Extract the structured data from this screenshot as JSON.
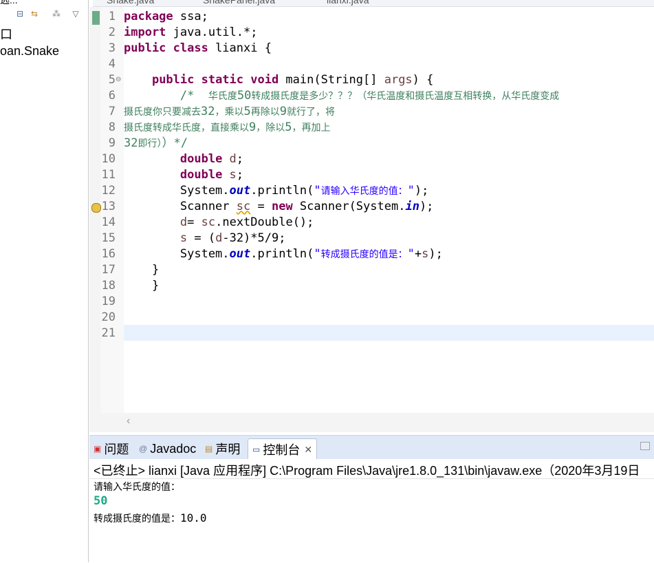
{
  "left": {
    "clipped_top": "逃...",
    "items": [
      "口",
      "oan.Snake"
    ]
  },
  "tabs": [
    "Snake.java",
    "SnakePanel.java",
    "lianxi.java"
  ],
  "editor": {
    "lines": [
      {
        "n": "1"
      },
      {
        "n": "2"
      },
      {
        "n": "3"
      },
      {
        "n": "4"
      },
      {
        "n": "5"
      },
      {
        "n": "6"
      },
      {
        "n": "7"
      },
      {
        "n": "8"
      },
      {
        "n": "9"
      },
      {
        "n": "10"
      },
      {
        "n": "11"
      },
      {
        "n": "12"
      },
      {
        "n": "13"
      },
      {
        "n": "14"
      },
      {
        "n": "15"
      },
      {
        "n": "16"
      },
      {
        "n": "17"
      },
      {
        "n": "18"
      },
      {
        "n": "19"
      },
      {
        "n": "20"
      },
      {
        "n": "21"
      }
    ],
    "code": {
      "l1_kw": "package",
      "l1_rest": " ssa;",
      "l2_kw": "import",
      "l2_rest": " java.util.*;",
      "l3_kw": "public class",
      "l3_rest": " lianxi {",
      "l5_indent": "    ",
      "l5_kw": "public static void",
      "l5_a": " main(String[] ",
      "l5_var": "args",
      "l5_b": ") {",
      "l6_a": "        /*  ",
      "l6_cn1": "华氏度",
      "l6_num": "50",
      "l6_cn2": "转成摄氏度是多少？？？（华氏温度和摄氏温度互相转换，从华氏度变成",
      "l7_cn1": "摄氏度你只要减去",
      "l7_n1": "32",
      "l7_cn2": "，乘以",
      "l7_n2": "5",
      "l7_cn3": "再除以",
      "l7_n3": "9",
      "l7_cn4": "就行了，将",
      "l8_cn1": "摄氏度转成华氏度，直接乘以",
      "l8_n1": "9",
      "l8_cn2": "，除以",
      "l8_n2": "5",
      "l8_cn3": "，再加上",
      "l9_n": "32",
      "l9_cn": "即行）",
      "l9_end": "）*/",
      "l10_i": "        ",
      "l10_kw": "double",
      "l10_var": " d",
      "l10_end": ";",
      "l11_i": "        ",
      "l11_kw": "double",
      "l11_var": " s",
      "l11_end": ";",
      "l12_a": "        System.",
      "l12_fld": "out",
      "l12_b": ".println(",
      "l12_q1": "\"",
      "l12_str": "请输入华氏度的值：",
      "l12_q2": "\"",
      "l12_c": ");",
      "l13_a": "        Scanner ",
      "l13_var": "sc",
      "l13_b": " = ",
      "l13_kw": "new",
      "l13_c": " Scanner(System.",
      "l13_fld": "in",
      "l13_d": ");",
      "l14_a": "        ",
      "l14_var": "d",
      "l14_b": "= ",
      "l14_var2": "sc",
      "l14_c": ".nextDouble();",
      "l15_a": "        ",
      "l15_var": "s",
      "l15_b": " = (",
      "l15_var2": "d",
      "l15_c": "-32)*5/9;",
      "l16_a": "        System.",
      "l16_fld": "out",
      "l16_b": ".println(",
      "l16_q1": "\"",
      "l16_str": "转成摄氏度的值是：",
      "l16_q2": "\"",
      "l16_c": "+",
      "l16_var": "s",
      "l16_d": ");",
      "l17": "    }",
      "l18": "    }"
    }
  },
  "console": {
    "tabs": {
      "problems": "问题",
      "javadoc": "Javadoc",
      "declaration": "声明",
      "console": "控制台"
    },
    "close_glyph": "✕",
    "status": "<已终止> lianxi [Java 应用程序] C:\\Program Files\\Java\\jre1.8.0_131\\bin\\javaw.exe（2020年3月19日",
    "output": {
      "prompt": "请输入华氏度的值：",
      "input": "50",
      "result_label": "转成摄氏度的值是：",
      "result_value": "10.0"
    }
  },
  "colors": {
    "keyword": "#7f0055",
    "comment": "#3f7f5f",
    "string": "#2a00ff",
    "field": "#0000c0",
    "console_input": "#1ea886",
    "current_line": "#e8f2fe"
  },
  "icons": {
    "collapse_all": "collapse-all-icon",
    "link_editor": "link-with-editor-icon",
    "view_menu": "view-menu-icon",
    "warning": "warning-icon"
  }
}
